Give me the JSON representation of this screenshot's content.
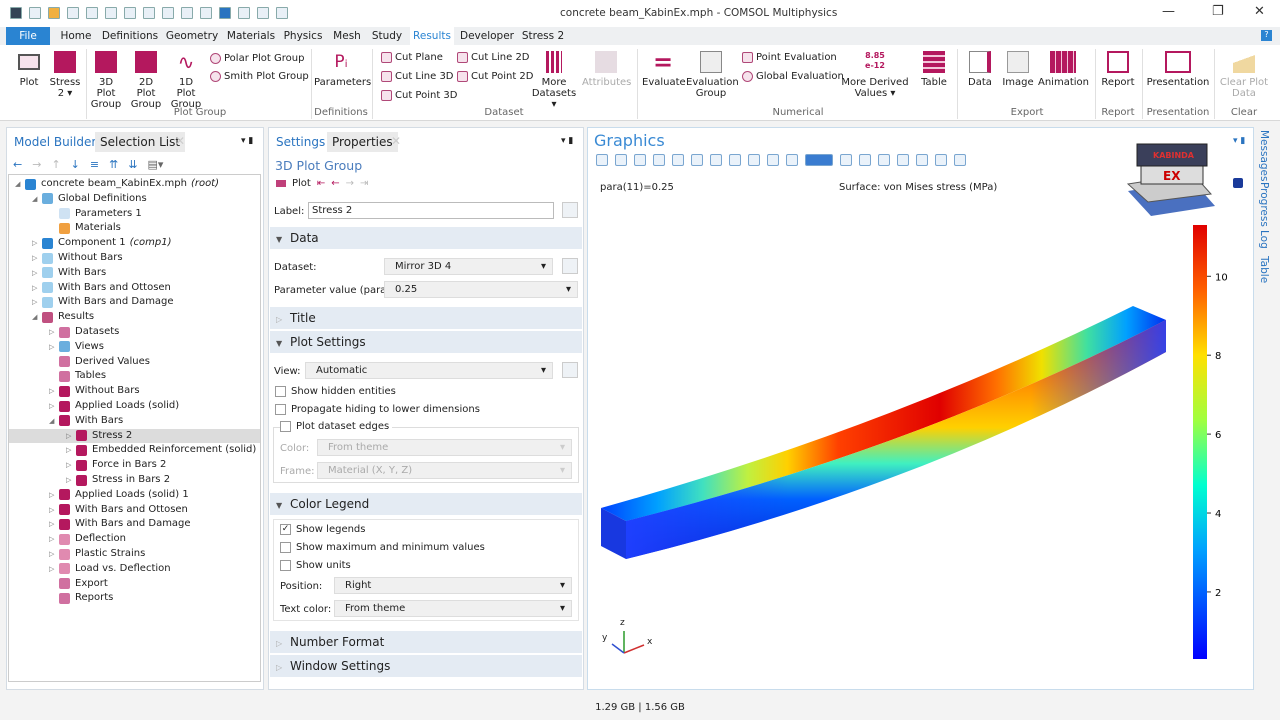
{
  "window": {
    "title": "concrete beam_KabinEx.mph - COMSOL Multiphysics",
    "minimize": "—",
    "restore": "❐",
    "close": "✕"
  },
  "menu_tabs": [
    "File",
    "Home",
    "Definitions",
    "Geometry",
    "Materials",
    "Physics",
    "Mesh",
    "Study",
    "Results",
    "Developer",
    "Stress 2"
  ],
  "active_tab": "Results",
  "ribbon": {
    "buttons": [
      {
        "label": "Plot",
        "icon": "plot-icon"
      },
      {
        "label": "Stress 2 ▾",
        "icon": "cube-icon"
      },
      {
        "label": "3D Plot Group",
        "icon": "cube-icon"
      },
      {
        "label": "2D Plot Group",
        "icon": "square-icon"
      },
      {
        "label": "1D Plot Group",
        "icon": "wave-icon"
      },
      {
        "label": "Parameters",
        "icon": "pi-icon"
      },
      {
        "label": "More Datasets ▾",
        "icon": "grid-icon"
      },
      {
        "label": "Attributes",
        "icon": "attributes-icon"
      },
      {
        "label": "Evaluate",
        "icon": "equals-icon"
      },
      {
        "label": "Evaluation Group",
        "icon": "evaluation-group-icon"
      },
      {
        "label": "More Derived Values ▾",
        "icon": "number-icon"
      },
      {
        "label": "Table",
        "icon": "table-icon"
      },
      {
        "label": "Data",
        "icon": "data-export-icon"
      },
      {
        "label": "Image",
        "icon": "image-icon"
      },
      {
        "label": "Animation",
        "icon": "film-icon"
      },
      {
        "label": "Report",
        "icon": "report-icon"
      },
      {
        "label": "Presentation",
        "icon": "presentation-icon"
      },
      {
        "label": "Clear Plot Data",
        "icon": "broom-icon"
      }
    ],
    "small": [
      "Polar Plot Group",
      "Smith Plot Group",
      "Cut Plane",
      "Cut Line 3D",
      "Cut Point 3D",
      "Cut Line 2D",
      "Cut Point 2D",
      "Point Evaluation",
      "Global Evaluation"
    ],
    "groups": [
      "Plot Group",
      "Definitions",
      "Dataset",
      "Numerical",
      "Export",
      "Report",
      "Presentation",
      "Clear"
    ],
    "number_icon_text": "8.85\ne-12"
  },
  "model_builder": {
    "tabs": [
      "Model Builder",
      "Selection List"
    ],
    "tree": [
      {
        "label": "concrete beam_KabinEx.mph",
        "suffix": "(root)",
        "level": 0,
        "exp": "◢",
        "color": "#2a84d2"
      },
      {
        "label": "Global Definitions",
        "level": 1,
        "exp": "◢",
        "color": "#6aaede"
      },
      {
        "label": "Parameters 1",
        "level": 2,
        "exp": "",
        "color": "#cfe2f3"
      },
      {
        "label": "Materials",
        "level": 2,
        "exp": "",
        "color": "#f0a040"
      },
      {
        "label": "Component 1",
        "suffix": "(comp1)",
        "level": 1,
        "exp": "▷",
        "color": "#2a84d2"
      },
      {
        "label": "Without Bars",
        "level": 1,
        "exp": "▷",
        "color": "#9fd0ee"
      },
      {
        "label": "With Bars",
        "level": 1,
        "exp": "▷",
        "color": "#9fd0ee"
      },
      {
        "label": "With Bars and Ottosen",
        "level": 1,
        "exp": "▷",
        "color": "#9fd0ee"
      },
      {
        "label": "With Bars and Damage",
        "level": 1,
        "exp": "▷",
        "color": "#9fd0ee"
      },
      {
        "label": "Results",
        "level": 1,
        "exp": "◢",
        "color": "#c05080"
      },
      {
        "label": "Datasets",
        "level": 2,
        "exp": "▷",
        "color": "#d070a0"
      },
      {
        "label": "Views",
        "level": 2,
        "exp": "▷",
        "color": "#6aaede"
      },
      {
        "label": "Derived Values",
        "level": 2,
        "exp": "",
        "color": "#d070a0"
      },
      {
        "label": "Tables",
        "level": 2,
        "exp": "",
        "color": "#d070a0"
      },
      {
        "label": "Without Bars",
        "level": 2,
        "exp": "▷",
        "color": "#b4185e"
      },
      {
        "label": "Applied Loads (solid)",
        "level": 2,
        "exp": "▷",
        "color": "#b4185e"
      },
      {
        "label": "With Bars",
        "level": 2,
        "exp": "◢",
        "color": "#b4185e"
      },
      {
        "label": "Stress 2",
        "level": 3,
        "exp": "▷",
        "color": "#b4185e",
        "selected": true
      },
      {
        "label": "Embedded Reinforcement (solid)",
        "level": 3,
        "exp": "▷",
        "color": "#b4185e"
      },
      {
        "label": "Force in Bars 2",
        "level": 3,
        "exp": "▷",
        "color": "#b4185e"
      },
      {
        "label": "Stress in Bars 2",
        "level": 3,
        "exp": "▷",
        "color": "#b4185e"
      },
      {
        "label": "Applied Loads (solid) 1",
        "level": 2,
        "exp": "▷",
        "color": "#b4185e"
      },
      {
        "label": "With Bars and Ottosen",
        "level": 2,
        "exp": "▷",
        "color": "#b4185e"
      },
      {
        "label": "With Bars and Damage",
        "level": 2,
        "exp": "▷",
        "color": "#b4185e"
      },
      {
        "label": "Deflection",
        "level": 2,
        "exp": "▷",
        "color": "#e08ab0"
      },
      {
        "label": "Plastic Strains",
        "level": 2,
        "exp": "▷",
        "color": "#e08ab0"
      },
      {
        "label": "Load vs. Deflection",
        "level": 2,
        "exp": "▷",
        "color": "#e08ab0"
      },
      {
        "label": "Export",
        "level": 2,
        "exp": "",
        "color": "#d070a0"
      },
      {
        "label": "Reports",
        "level": 2,
        "exp": "",
        "color": "#d070a0"
      }
    ]
  },
  "settings": {
    "tabs": [
      "Settings",
      "Properties"
    ],
    "heading": "3D Plot Group",
    "plot_label": "Plot",
    "label_field": {
      "label": "Label:",
      "value": "Stress 2"
    },
    "sections": {
      "data": "Data",
      "title": "Title",
      "plot_settings": "Plot Settings",
      "color_legend": "Color Legend",
      "number_format": "Number Format",
      "window_settings": "Window Settings"
    },
    "dataset": {
      "label": "Dataset:",
      "value": "Mirror 3D 4"
    },
    "parameter": {
      "label": "Parameter value (para):",
      "value": "0.25"
    },
    "view": {
      "label": "View:",
      "value": "Automatic"
    },
    "show_hidden": {
      "label": "Show hidden entities",
      "checked": false
    },
    "propagate": {
      "label": "Propagate hiding to lower dimensions",
      "checked": false
    },
    "plot_edges": {
      "label": "Plot dataset edges",
      "checked": false
    },
    "color": {
      "label": "Color:",
      "value": "From theme"
    },
    "frame": {
      "label": "Frame:",
      "value": "Material  (X, Y, Z)"
    },
    "show_legends": {
      "label": "Show legends",
      "checked": true
    },
    "show_maxmin": {
      "label": "Show maximum and minimum values",
      "checked": false
    },
    "show_units": {
      "label": "Show units",
      "checked": false
    },
    "position": {
      "label": "Position:",
      "value": "Right"
    },
    "text_color": {
      "label": "Text color:",
      "value": "From theme"
    }
  },
  "graphics": {
    "title": "Graphics",
    "param_text": "para(11)=0.25",
    "surface_text": "Surface: von Mises stress (MPa)",
    "legend": {
      "ticks": [
        "2",
        "4",
        "6",
        "8",
        "10"
      ],
      "min": 0.3,
      "max": 11.3
    },
    "axes": {
      "x": "x",
      "y": "y",
      "z": "z"
    },
    "logo_text": [
      "KABINDA",
      "EX"
    ]
  },
  "side_tabs": [
    "Messages",
    "Progress",
    "Log",
    "Table"
  ],
  "status": {
    "memory": "1.29 GB | 1.56 GB"
  },
  "colors": {
    "accent": "#2a84d2",
    "results": "#b4185e"
  }
}
